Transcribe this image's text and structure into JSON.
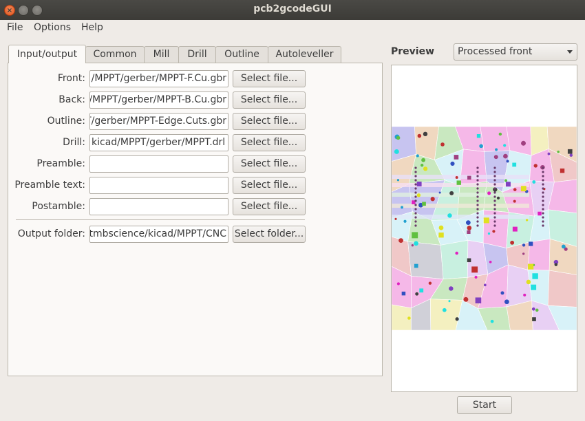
{
  "window": {
    "title": "pcb2gcodeGUI"
  },
  "menu": {
    "file": "File",
    "options": "Options",
    "help": "Help"
  },
  "tabs": [
    {
      "label": "Input/output",
      "active": true
    },
    {
      "label": "Common"
    },
    {
      "label": "Mill"
    },
    {
      "label": "Drill"
    },
    {
      "label": "Outline"
    },
    {
      "label": "Autoleveller"
    }
  ],
  "form": {
    "front": {
      "label": "Front:",
      "value": "/MPPT/gerber/MPPT-F.Cu.gbr",
      "button": "Select file..."
    },
    "back": {
      "label": "Back:",
      "value": "/MPPT/gerber/MPPT-B.Cu.gbr",
      "button": "Select file..."
    },
    "outline": {
      "label": "Outline:",
      "value": "T/gerber/MPPT-Edge.Cuts.gbr",
      "button": "Select file..."
    },
    "drill": {
      "label": "Drill:",
      "value": "kicad/MPPT/gerber/MPPT.drl",
      "button": "Select file..."
    },
    "preamble": {
      "label": "Preamble:",
      "value": "",
      "button": "Select file..."
    },
    "preamble_text": {
      "label": "Preamble text:",
      "value": "",
      "button": "Select file..."
    },
    "postamble": {
      "label": "Postamble:",
      "value": "",
      "button": "Select file..."
    },
    "output_folder": {
      "label": "Output folder:",
      "value": "tmbscience/kicad/MPPT/CNC",
      "button": "Select folder..."
    }
  },
  "preview": {
    "label": "Preview",
    "selected_view": "Processed front",
    "image_colors": [
      "#f5b8e8",
      "#c9e8c0",
      "#c7c4f0",
      "#f0c8c8",
      "#d8f2f8",
      "#f4f0c0",
      "#e8d0f4",
      "#c8f0e0",
      "#f0d8c0",
      "#d0d0d8"
    ]
  },
  "actions": {
    "start": "Start"
  }
}
